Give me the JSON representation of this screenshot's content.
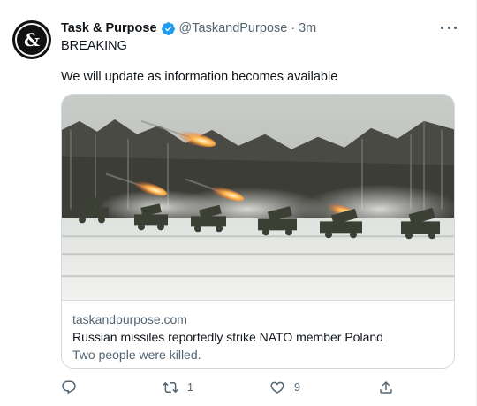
{
  "tweet": {
    "author_name": "Task & Purpose",
    "author_handle": "@TaskandPurpose",
    "separator": "·",
    "time": "3m",
    "avatar_glyph": "&",
    "line1": "BREAKING",
    "line2": "We will update as information becomes available"
  },
  "card": {
    "domain": "taskandpurpose.com",
    "title": "Russian missiles reportedly strike NATO member Poland",
    "description": "Two people were killed.",
    "image_icon": "rocket-launchers-photo"
  },
  "actions": {
    "reply_icon": "reply-icon",
    "retweet_icon": "retweet-icon",
    "retweet_count": "1",
    "like_icon": "heart-icon",
    "like_count": "9",
    "share_icon": "share-icon"
  },
  "colors": {
    "accent": "#1d9bf0",
    "text": "#0f1419",
    "muted": "#536471",
    "border": "#cfd9de"
  }
}
